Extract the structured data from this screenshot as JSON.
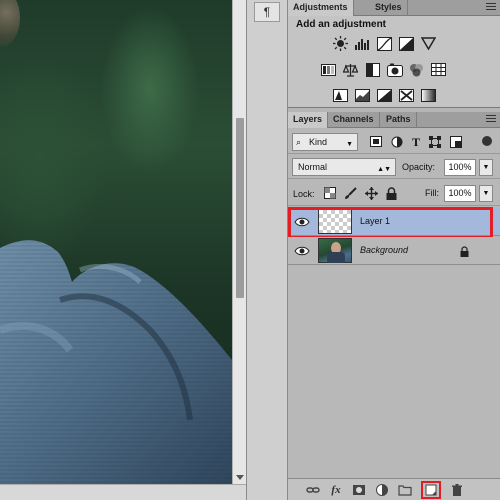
{
  "dock": {
    "paragraph_symbol": "¶"
  },
  "adjustments": {
    "tabs": [
      "Adjustments",
      "Styles"
    ],
    "title": "Add an adjustment",
    "row1": [
      "brightness-contrast-icon",
      "levels-icon",
      "curves-icon",
      "exposure-icon",
      "triangle-vibrance-icon"
    ],
    "row2": [
      "hue-saturation-icon",
      "color-balance-icon",
      "black-white-icon",
      "photo-filter-icon",
      "channel-mixer-icon",
      "color-lookup-icon"
    ],
    "row3": [
      "invert-icon",
      "posterize-icon",
      "threshold-icon",
      "selective-color-icon",
      "gradient-map-icon"
    ]
  },
  "layers": {
    "tabs": [
      "Layers",
      "Channels",
      "Paths"
    ],
    "filter_kind": "Kind",
    "blend_mode": "Normal",
    "opacity_label": "Opacity:",
    "opacity_value": "100%",
    "lock_label": "Lock:",
    "fill_label": "Fill:",
    "fill_value": "100%",
    "items": [
      {
        "name": "Layer 1",
        "selected": true,
        "visible": true
      },
      {
        "name": "Background",
        "selected": false,
        "visible": true,
        "locked": true
      }
    ],
    "footer": [
      "link-icon",
      "fx-icon",
      "mask-icon",
      "adjustment-layer-icon",
      "folder-icon",
      "new-layer-icon",
      "trash-icon"
    ]
  },
  "colors": {
    "highlight": "#e41c23",
    "selected_layer": "#a4b8dc"
  }
}
